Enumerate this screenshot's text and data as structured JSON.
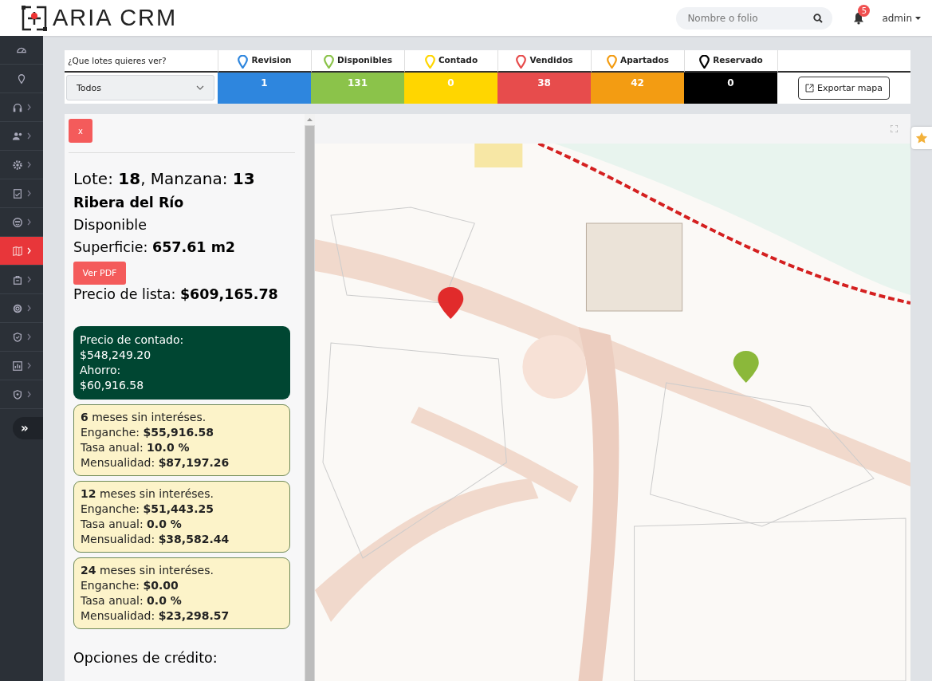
{
  "header": {
    "logo_text": "ARIA CRM",
    "search": {
      "placeholder": "Nombre o folio"
    },
    "notifications": {
      "count": "5"
    },
    "user": "admin"
  },
  "sidebar": {
    "items": [
      {
        "selected": false,
        "expandable": false
      },
      {
        "selected": false,
        "expandable": false
      },
      {
        "selected": false,
        "expandable": true
      },
      {
        "selected": false,
        "expandable": true
      },
      {
        "selected": false,
        "expandable": true
      },
      {
        "selected": false,
        "expandable": true
      },
      {
        "selected": false,
        "expandable": true
      },
      {
        "selected": true,
        "expandable": true
      },
      {
        "selected": false,
        "expandable": true
      },
      {
        "selected": false,
        "expandable": true
      },
      {
        "selected": false,
        "expandable": true
      },
      {
        "selected": false,
        "expandable": true
      },
      {
        "selected": false,
        "expandable": true
      }
    ],
    "collapse_button": "»"
  },
  "filter": {
    "question": "¿Que lotes quieres ver?",
    "select": {
      "value": "Todos"
    },
    "statuses": [
      {
        "label": "Revision",
        "count": "1",
        "color": "#2e86de"
      },
      {
        "label": "Disponibles",
        "count": "131",
        "color": "#8bc34a"
      },
      {
        "label": "Contado",
        "count": "0",
        "color": "#ffd600"
      },
      {
        "label": "Vendidos",
        "count": "38",
        "color": "#e74c4c"
      },
      {
        "label": "Apartados",
        "count": "42",
        "color": "#f39c12"
      },
      {
        "label": "Reservado",
        "count": "0",
        "color": "#000000"
      }
    ],
    "export_button": "Exportar mapa"
  },
  "lot_panel": {
    "close_button": "x",
    "title": "Lote: **18**, Manzana: **13**",
    "development": "Ribera del Río",
    "status": "Disponible",
    "area": "Superficie: **657.61 m2**",
    "pdf_button": "Ver PDF",
    "list_price": "Precio de lista: **$609,165.78**",
    "cash_offer": [
      "Precio de contado:",
      "$548,249.20",
      "Ahorro:",
      "$60,916.58"
    ],
    "plans": [
      {
        "lines": [
          "**6** meses sin interéses.",
          "Enganche: **$55,916.58**",
          "Tasa anual: **10.0 %**",
          "Mensualidad: **$87,197.26**"
        ]
      },
      {
        "lines": [
          "**12** meses sin interéses.",
          "Enganche: **$51,443.25**",
          "Tasa anual: **0.0 %**",
          "Mensualidad: **$38,582.44**"
        ]
      },
      {
        "lines": [
          "**24** meses sin interéses.",
          "Enganche: **$0.00**",
          "Tasa anual: **0.0 %**",
          "Mensualidad: **$23,298.57**"
        ]
      }
    ],
    "credit_heading": "Opciones de crédito:"
  }
}
